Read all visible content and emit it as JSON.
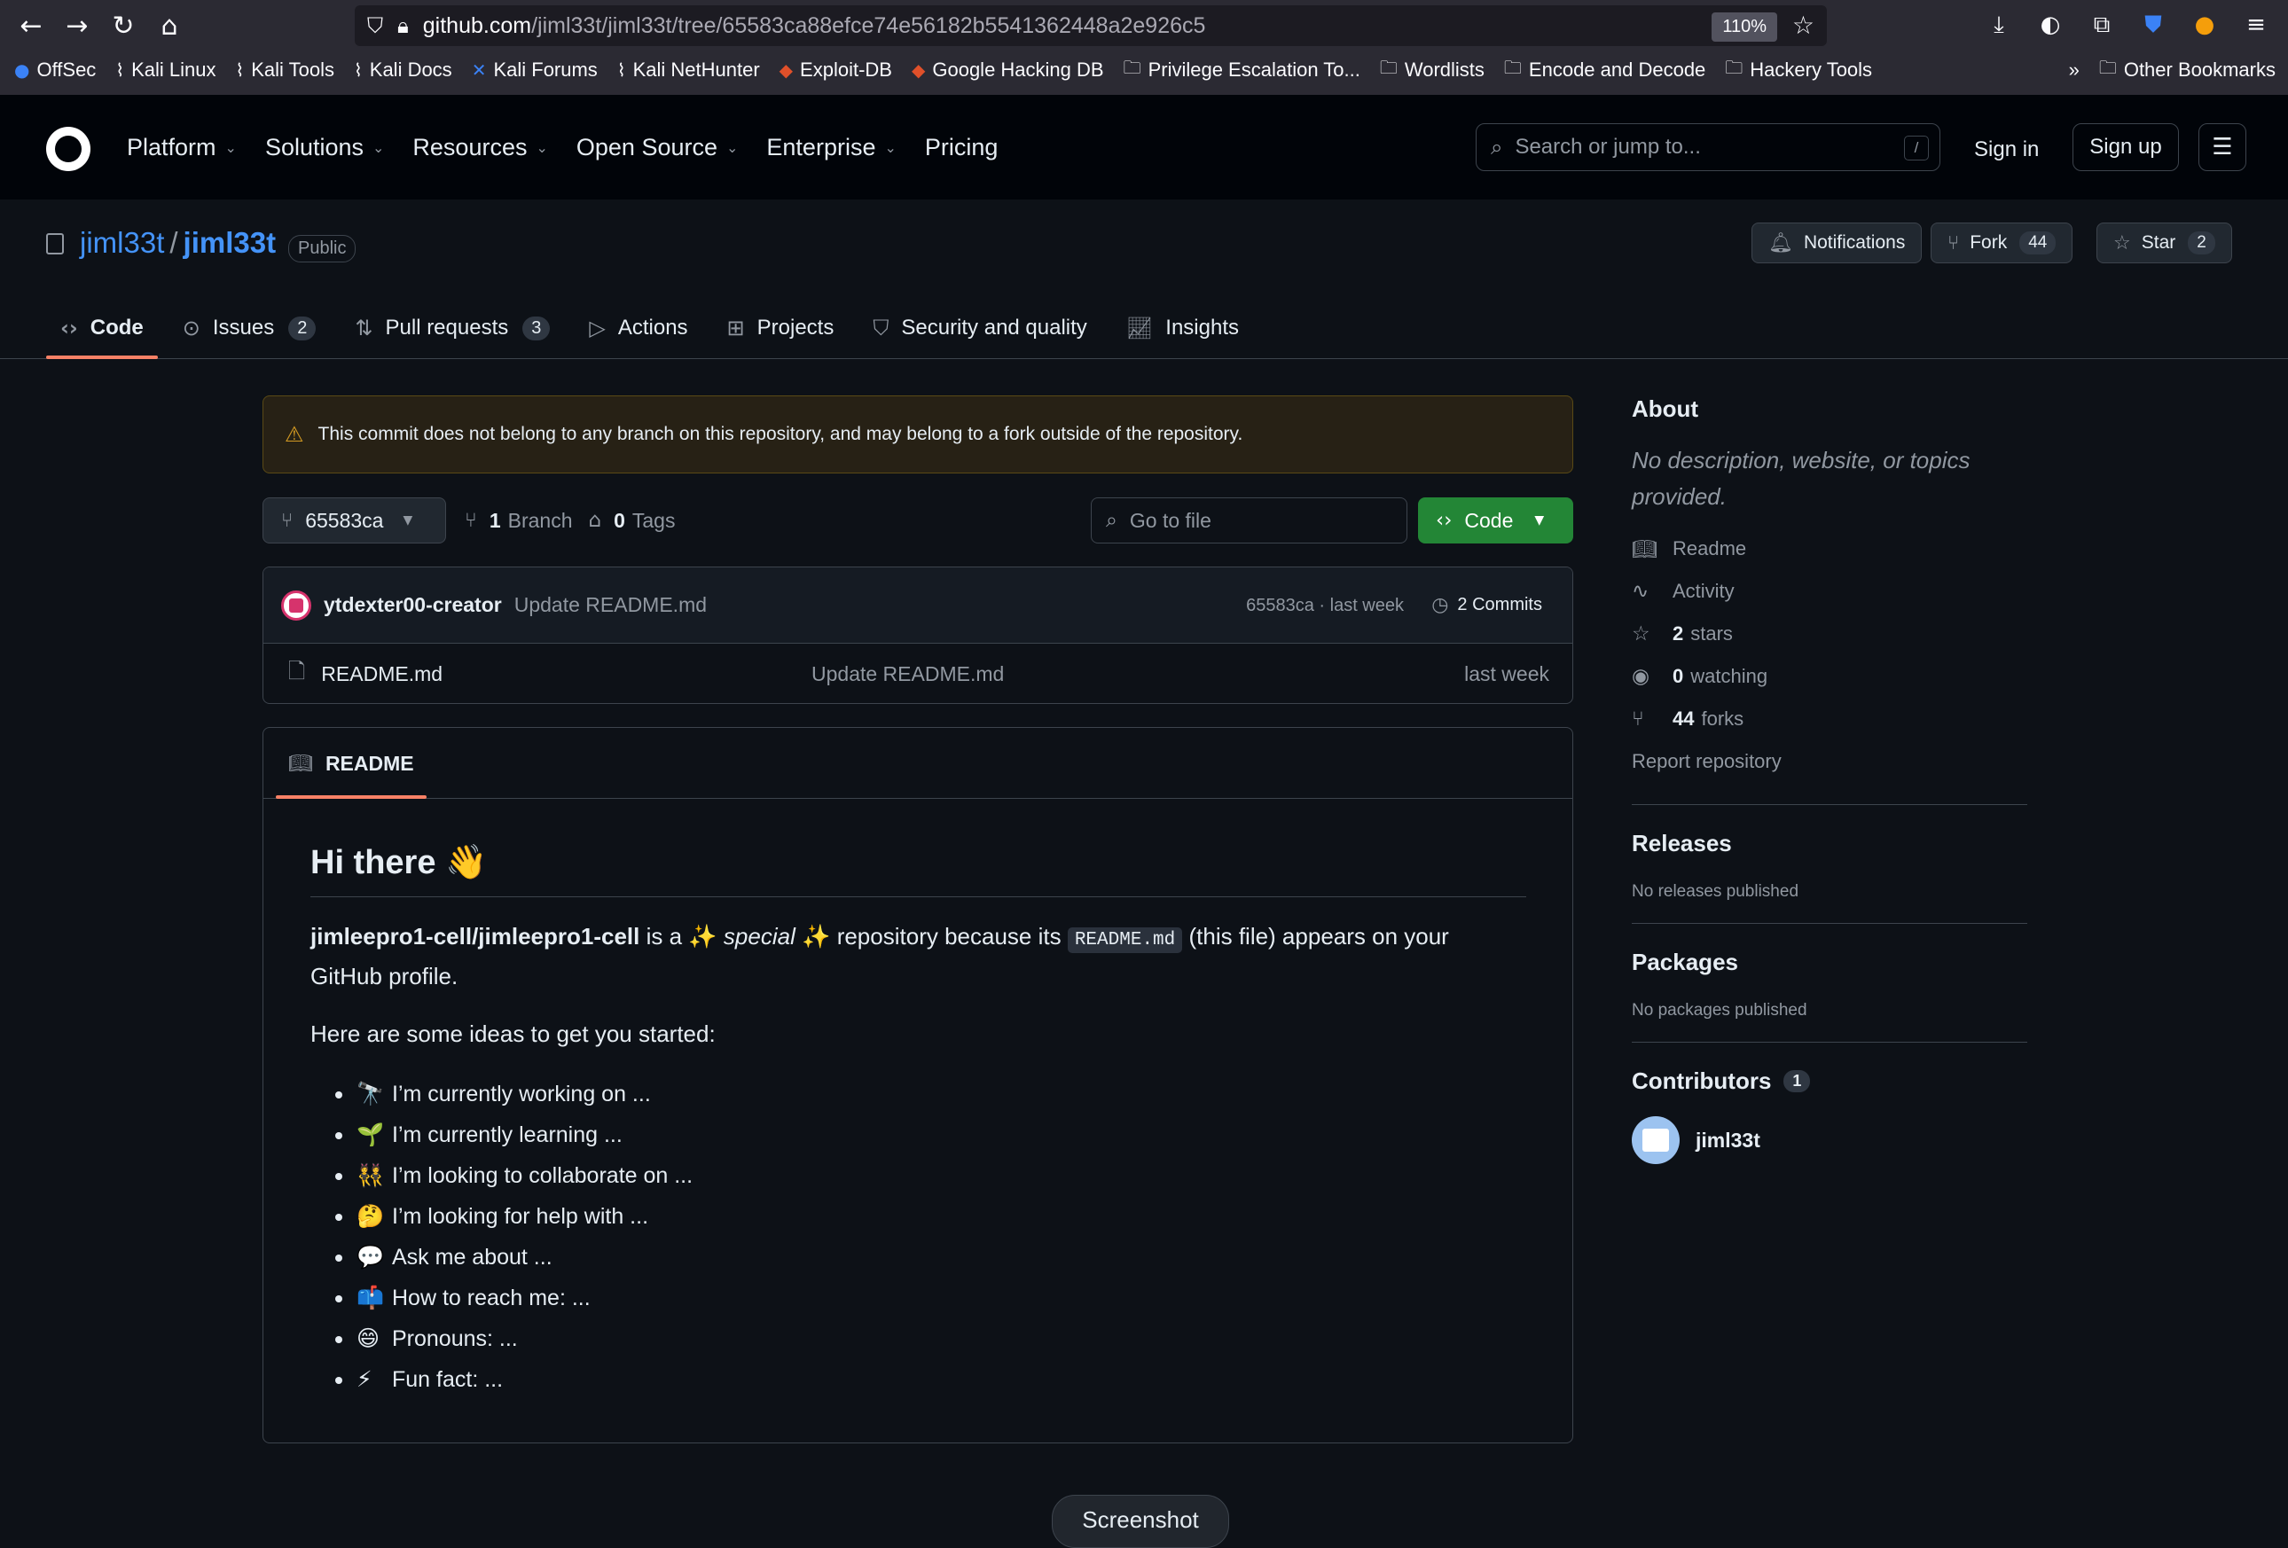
{
  "browser": {
    "url_host": "github.com",
    "url_path": "/jiml33t/jiml33t/tree/65583ca88efce74e56182b5541362448a2e926c5",
    "zoom": "110%",
    "bookmarks": [
      "OffSec",
      "Kali Linux",
      "Kali Tools",
      "Kali Docs",
      "Kali Forums",
      "Kali NetHunter",
      "Exploit-DB",
      "Google Hacking DB",
      "Privilege Escalation To...",
      "Wordlists",
      "Encode and Decode",
      "Hackery Tools"
    ],
    "other_bookmarks": "Other Bookmarks"
  },
  "header": {
    "menu": [
      "Platform",
      "Solutions",
      "Resources",
      "Open Source",
      "Enterprise",
      "Pricing"
    ],
    "search_placeholder": "Search or jump to...",
    "search_shortcut": "/",
    "sign_in": "Sign in",
    "sign_up": "Sign up"
  },
  "repo": {
    "owner": "jiml33t",
    "separator": "/",
    "name": "jiml33t",
    "visibility": "Public",
    "notifications": "Notifications",
    "fork_label": "Fork",
    "fork_count": "44",
    "star_label": "Star",
    "star_count": "2"
  },
  "tabs": [
    {
      "label": "Code",
      "count": ""
    },
    {
      "label": "Issues",
      "count": "2"
    },
    {
      "label": "Pull requests",
      "count": "3"
    },
    {
      "label": "Actions",
      "count": ""
    },
    {
      "label": "Projects",
      "count": ""
    },
    {
      "label": "Security and quality",
      "count": ""
    },
    {
      "label": "Insights",
      "count": ""
    }
  ],
  "warning": "This commit does not belong to any branch on this repository, and may belong to a fork outside of the repository.",
  "toolbar": {
    "branch": "65583ca",
    "branch_count": "1",
    "branch_label": "Branch",
    "tag_count": "0",
    "tag_label": "Tags",
    "goto_placeholder": "Go to file",
    "code_label": "Code"
  },
  "commit": {
    "user": "ytdexter00-creator",
    "message": "Update README.md",
    "meta": "65583ca · last week",
    "commits": "2 Commits"
  },
  "files": [
    {
      "name": "README.md",
      "message": "Update README.md",
      "date": "last week"
    }
  ],
  "readme": {
    "tab": "README",
    "heading": "Hi there 👋",
    "intro_bold": "jimleepro1-cell/jimleepro1-cell",
    "intro_is": " is a ",
    "intro_special": "special",
    "intro_mid": " repository because its ",
    "intro_code": "README.md",
    "intro_end": " (this file) appears on your GitHub profile.",
    "ideas_intro": "Here are some ideas to get you started:",
    "ideas": [
      {
        "emoji": "🔭",
        "text": "I’m currently working on ..."
      },
      {
        "emoji": "🌱",
        "text": "I’m currently learning ..."
      },
      {
        "emoji": "👯",
        "text": "I’m looking to collaborate on ..."
      },
      {
        "emoji": "🤔",
        "text": "I’m looking for help with ..."
      },
      {
        "emoji": "💬",
        "text": "Ask me about ..."
      },
      {
        "emoji": "📫",
        "text": "How to reach me: ..."
      },
      {
        "emoji": "😄",
        "text": "Pronouns: ..."
      },
      {
        "emoji": "⚡",
        "text": "Fun fact: ..."
      }
    ]
  },
  "about": {
    "title": "About",
    "description": "No description, website, or topics provided.",
    "readme": "Readme",
    "activity": "Activity",
    "stars_count": "2",
    "stars_label": "stars",
    "watching_count": "0",
    "watching_label": "watching",
    "forks_count": "44",
    "forks_label": "forks",
    "report": "Report repository"
  },
  "releases": {
    "title": "Releases",
    "empty": "No releases published"
  },
  "packages": {
    "title": "Packages",
    "empty": "No packages published"
  },
  "contributors": {
    "title": "Contributors",
    "count": "1",
    "user": "jiml33t"
  },
  "overlay": "Screenshot"
}
